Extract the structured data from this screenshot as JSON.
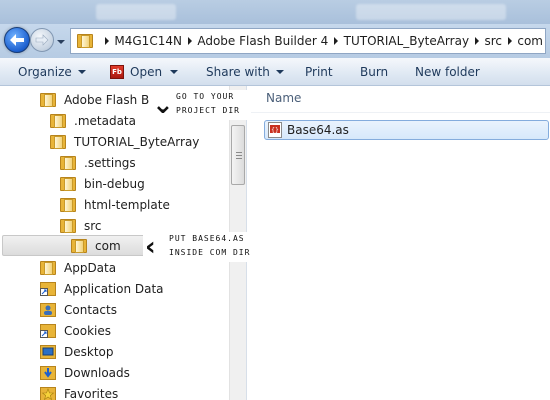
{
  "address_bar": {
    "path": [
      "M4G1C14N",
      "Adobe Flash Builder 4",
      "TUTORIAL_ByteArray",
      "src",
      "com"
    ]
  },
  "command_bar": {
    "organize": "Organize",
    "open": "Open",
    "share_with": "Share with",
    "print": "Print",
    "burn": "Burn",
    "new_folder": "New folder"
  },
  "nav_tree": {
    "items": [
      {
        "label": "Adobe Flash Builder",
        "icon": "folder-icon"
      },
      {
        "label": ".metadata",
        "icon": "folder-icon"
      },
      {
        "label": "TUTORIAL_ByteArray",
        "icon": "folder-icon"
      },
      {
        "label": ".settings",
        "icon": "folder-icon"
      },
      {
        "label": "bin-debug",
        "icon": "folder-icon"
      },
      {
        "label": "html-template",
        "icon": "folder-icon"
      },
      {
        "label": "src",
        "icon": "folder-icon"
      },
      {
        "label": "com",
        "icon": "folder-icon",
        "selected": true
      },
      {
        "label": "AppData",
        "icon": "folder-icon"
      },
      {
        "label": "Application Data",
        "icon": "shortcut-folder-icon"
      },
      {
        "label": "Contacts",
        "icon": "contacts-icon"
      },
      {
        "label": "Cookies",
        "icon": "shortcut-folder-icon"
      },
      {
        "label": "Desktop",
        "icon": "desktop-icon"
      },
      {
        "label": "Downloads",
        "icon": "downloads-icon"
      },
      {
        "label": "Favorites",
        "icon": "favorites-icon"
      }
    ]
  },
  "callouts": {
    "project_dir": [
      "GO TO YOUR",
      "PROJECT DIR"
    ],
    "com_dir": [
      "PUT BASE64.AS",
      "INSIDE COM DIR"
    ]
  },
  "file_list": {
    "column_name": "Name",
    "files": [
      {
        "name": "Base64.as",
        "icon": "actionscript-file-icon"
      }
    ]
  },
  "colors": {
    "accent": "#1c5fcf",
    "command_text": "#1e395b",
    "selection_border": "#84acdd"
  }
}
